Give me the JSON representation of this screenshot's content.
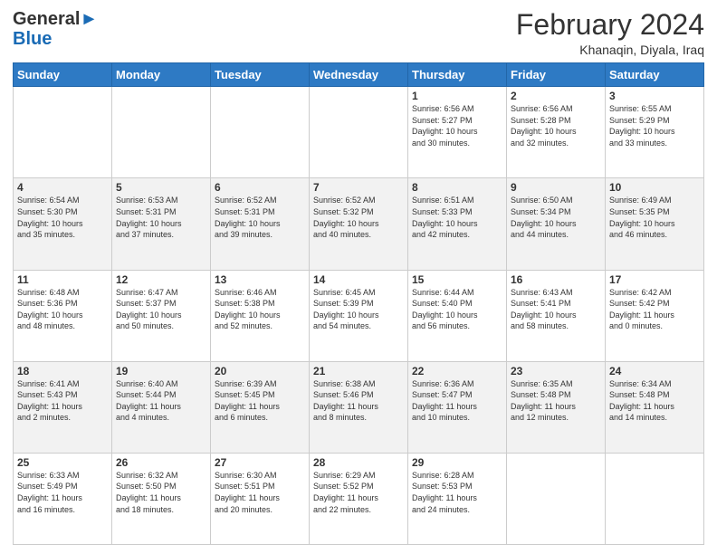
{
  "header": {
    "logo_line1": "General",
    "logo_line2": "Blue",
    "title": "February 2024",
    "location": "Khanaqin, Diyala, Iraq"
  },
  "weekdays": [
    "Sunday",
    "Monday",
    "Tuesday",
    "Wednesday",
    "Thursday",
    "Friday",
    "Saturday"
  ],
  "weeks": [
    [
      {
        "day": "",
        "info": ""
      },
      {
        "day": "",
        "info": ""
      },
      {
        "day": "",
        "info": ""
      },
      {
        "day": "",
        "info": ""
      },
      {
        "day": "1",
        "info": "Sunrise: 6:56 AM\nSunset: 5:27 PM\nDaylight: 10 hours\nand 30 minutes."
      },
      {
        "day": "2",
        "info": "Sunrise: 6:56 AM\nSunset: 5:28 PM\nDaylight: 10 hours\nand 32 minutes."
      },
      {
        "day": "3",
        "info": "Sunrise: 6:55 AM\nSunset: 5:29 PM\nDaylight: 10 hours\nand 33 minutes."
      }
    ],
    [
      {
        "day": "4",
        "info": "Sunrise: 6:54 AM\nSunset: 5:30 PM\nDaylight: 10 hours\nand 35 minutes."
      },
      {
        "day": "5",
        "info": "Sunrise: 6:53 AM\nSunset: 5:31 PM\nDaylight: 10 hours\nand 37 minutes."
      },
      {
        "day": "6",
        "info": "Sunrise: 6:52 AM\nSunset: 5:31 PM\nDaylight: 10 hours\nand 39 minutes."
      },
      {
        "day": "7",
        "info": "Sunrise: 6:52 AM\nSunset: 5:32 PM\nDaylight: 10 hours\nand 40 minutes."
      },
      {
        "day": "8",
        "info": "Sunrise: 6:51 AM\nSunset: 5:33 PM\nDaylight: 10 hours\nand 42 minutes."
      },
      {
        "day": "9",
        "info": "Sunrise: 6:50 AM\nSunset: 5:34 PM\nDaylight: 10 hours\nand 44 minutes."
      },
      {
        "day": "10",
        "info": "Sunrise: 6:49 AM\nSunset: 5:35 PM\nDaylight: 10 hours\nand 46 minutes."
      }
    ],
    [
      {
        "day": "11",
        "info": "Sunrise: 6:48 AM\nSunset: 5:36 PM\nDaylight: 10 hours\nand 48 minutes."
      },
      {
        "day": "12",
        "info": "Sunrise: 6:47 AM\nSunset: 5:37 PM\nDaylight: 10 hours\nand 50 minutes."
      },
      {
        "day": "13",
        "info": "Sunrise: 6:46 AM\nSunset: 5:38 PM\nDaylight: 10 hours\nand 52 minutes."
      },
      {
        "day": "14",
        "info": "Sunrise: 6:45 AM\nSunset: 5:39 PM\nDaylight: 10 hours\nand 54 minutes."
      },
      {
        "day": "15",
        "info": "Sunrise: 6:44 AM\nSunset: 5:40 PM\nDaylight: 10 hours\nand 56 minutes."
      },
      {
        "day": "16",
        "info": "Sunrise: 6:43 AM\nSunset: 5:41 PM\nDaylight: 10 hours\nand 58 minutes."
      },
      {
        "day": "17",
        "info": "Sunrise: 6:42 AM\nSunset: 5:42 PM\nDaylight: 11 hours\nand 0 minutes."
      }
    ],
    [
      {
        "day": "18",
        "info": "Sunrise: 6:41 AM\nSunset: 5:43 PM\nDaylight: 11 hours\nand 2 minutes."
      },
      {
        "day": "19",
        "info": "Sunrise: 6:40 AM\nSunset: 5:44 PM\nDaylight: 11 hours\nand 4 minutes."
      },
      {
        "day": "20",
        "info": "Sunrise: 6:39 AM\nSunset: 5:45 PM\nDaylight: 11 hours\nand 6 minutes."
      },
      {
        "day": "21",
        "info": "Sunrise: 6:38 AM\nSunset: 5:46 PM\nDaylight: 11 hours\nand 8 minutes."
      },
      {
        "day": "22",
        "info": "Sunrise: 6:36 AM\nSunset: 5:47 PM\nDaylight: 11 hours\nand 10 minutes."
      },
      {
        "day": "23",
        "info": "Sunrise: 6:35 AM\nSunset: 5:48 PM\nDaylight: 11 hours\nand 12 minutes."
      },
      {
        "day": "24",
        "info": "Sunrise: 6:34 AM\nSunset: 5:48 PM\nDaylight: 11 hours\nand 14 minutes."
      }
    ],
    [
      {
        "day": "25",
        "info": "Sunrise: 6:33 AM\nSunset: 5:49 PM\nDaylight: 11 hours\nand 16 minutes."
      },
      {
        "day": "26",
        "info": "Sunrise: 6:32 AM\nSunset: 5:50 PM\nDaylight: 11 hours\nand 18 minutes."
      },
      {
        "day": "27",
        "info": "Sunrise: 6:30 AM\nSunset: 5:51 PM\nDaylight: 11 hours\nand 20 minutes."
      },
      {
        "day": "28",
        "info": "Sunrise: 6:29 AM\nSunset: 5:52 PM\nDaylight: 11 hours\nand 22 minutes."
      },
      {
        "day": "29",
        "info": "Sunrise: 6:28 AM\nSunset: 5:53 PM\nDaylight: 11 hours\nand 24 minutes."
      },
      {
        "day": "",
        "info": ""
      },
      {
        "day": "",
        "info": ""
      }
    ]
  ]
}
